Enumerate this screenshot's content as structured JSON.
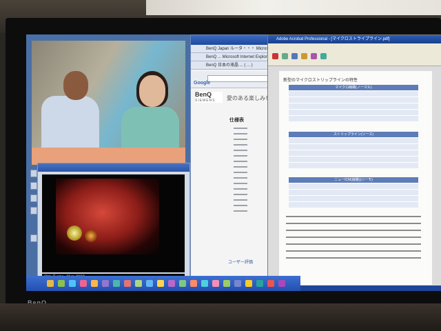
{
  "photo": {
    "monitor_brand": "BenQ"
  },
  "media_player": {
    "status_text": "Ctrl+T  size=2f m 2000"
  },
  "browser": {
    "tabs": [
      "BenQ Japan ルータ・・・ Microsoft",
      "BenQ ... Microsoft Internet Explorer",
      "BenQ 日本の液晶 ... ( ... )"
    ],
    "search_engine": "Google",
    "logo_text": "BenQ",
    "logo_subtext": "SIEMENS",
    "page_heading": "愛のある楽しみを",
    "spec_heading": "仕様表",
    "review_link": "ユーザー評価"
  },
  "acrobat": {
    "title": "Adobe Acrobat Professional - [マイクロストライプライン.pdf]",
    "doc_heading": "新型のマイクロストリップラインの特性",
    "table_headers": [
      "マイクロ線路(ノーマル)",
      "ストリップライン(ソース)",
      "ニューICM(線路)(ハーモ)"
    ]
  },
  "colors": {
    "desktop": "#4a6fa5",
    "taskbar": "#2350b0",
    "table_header": "#5e7cb8"
  }
}
